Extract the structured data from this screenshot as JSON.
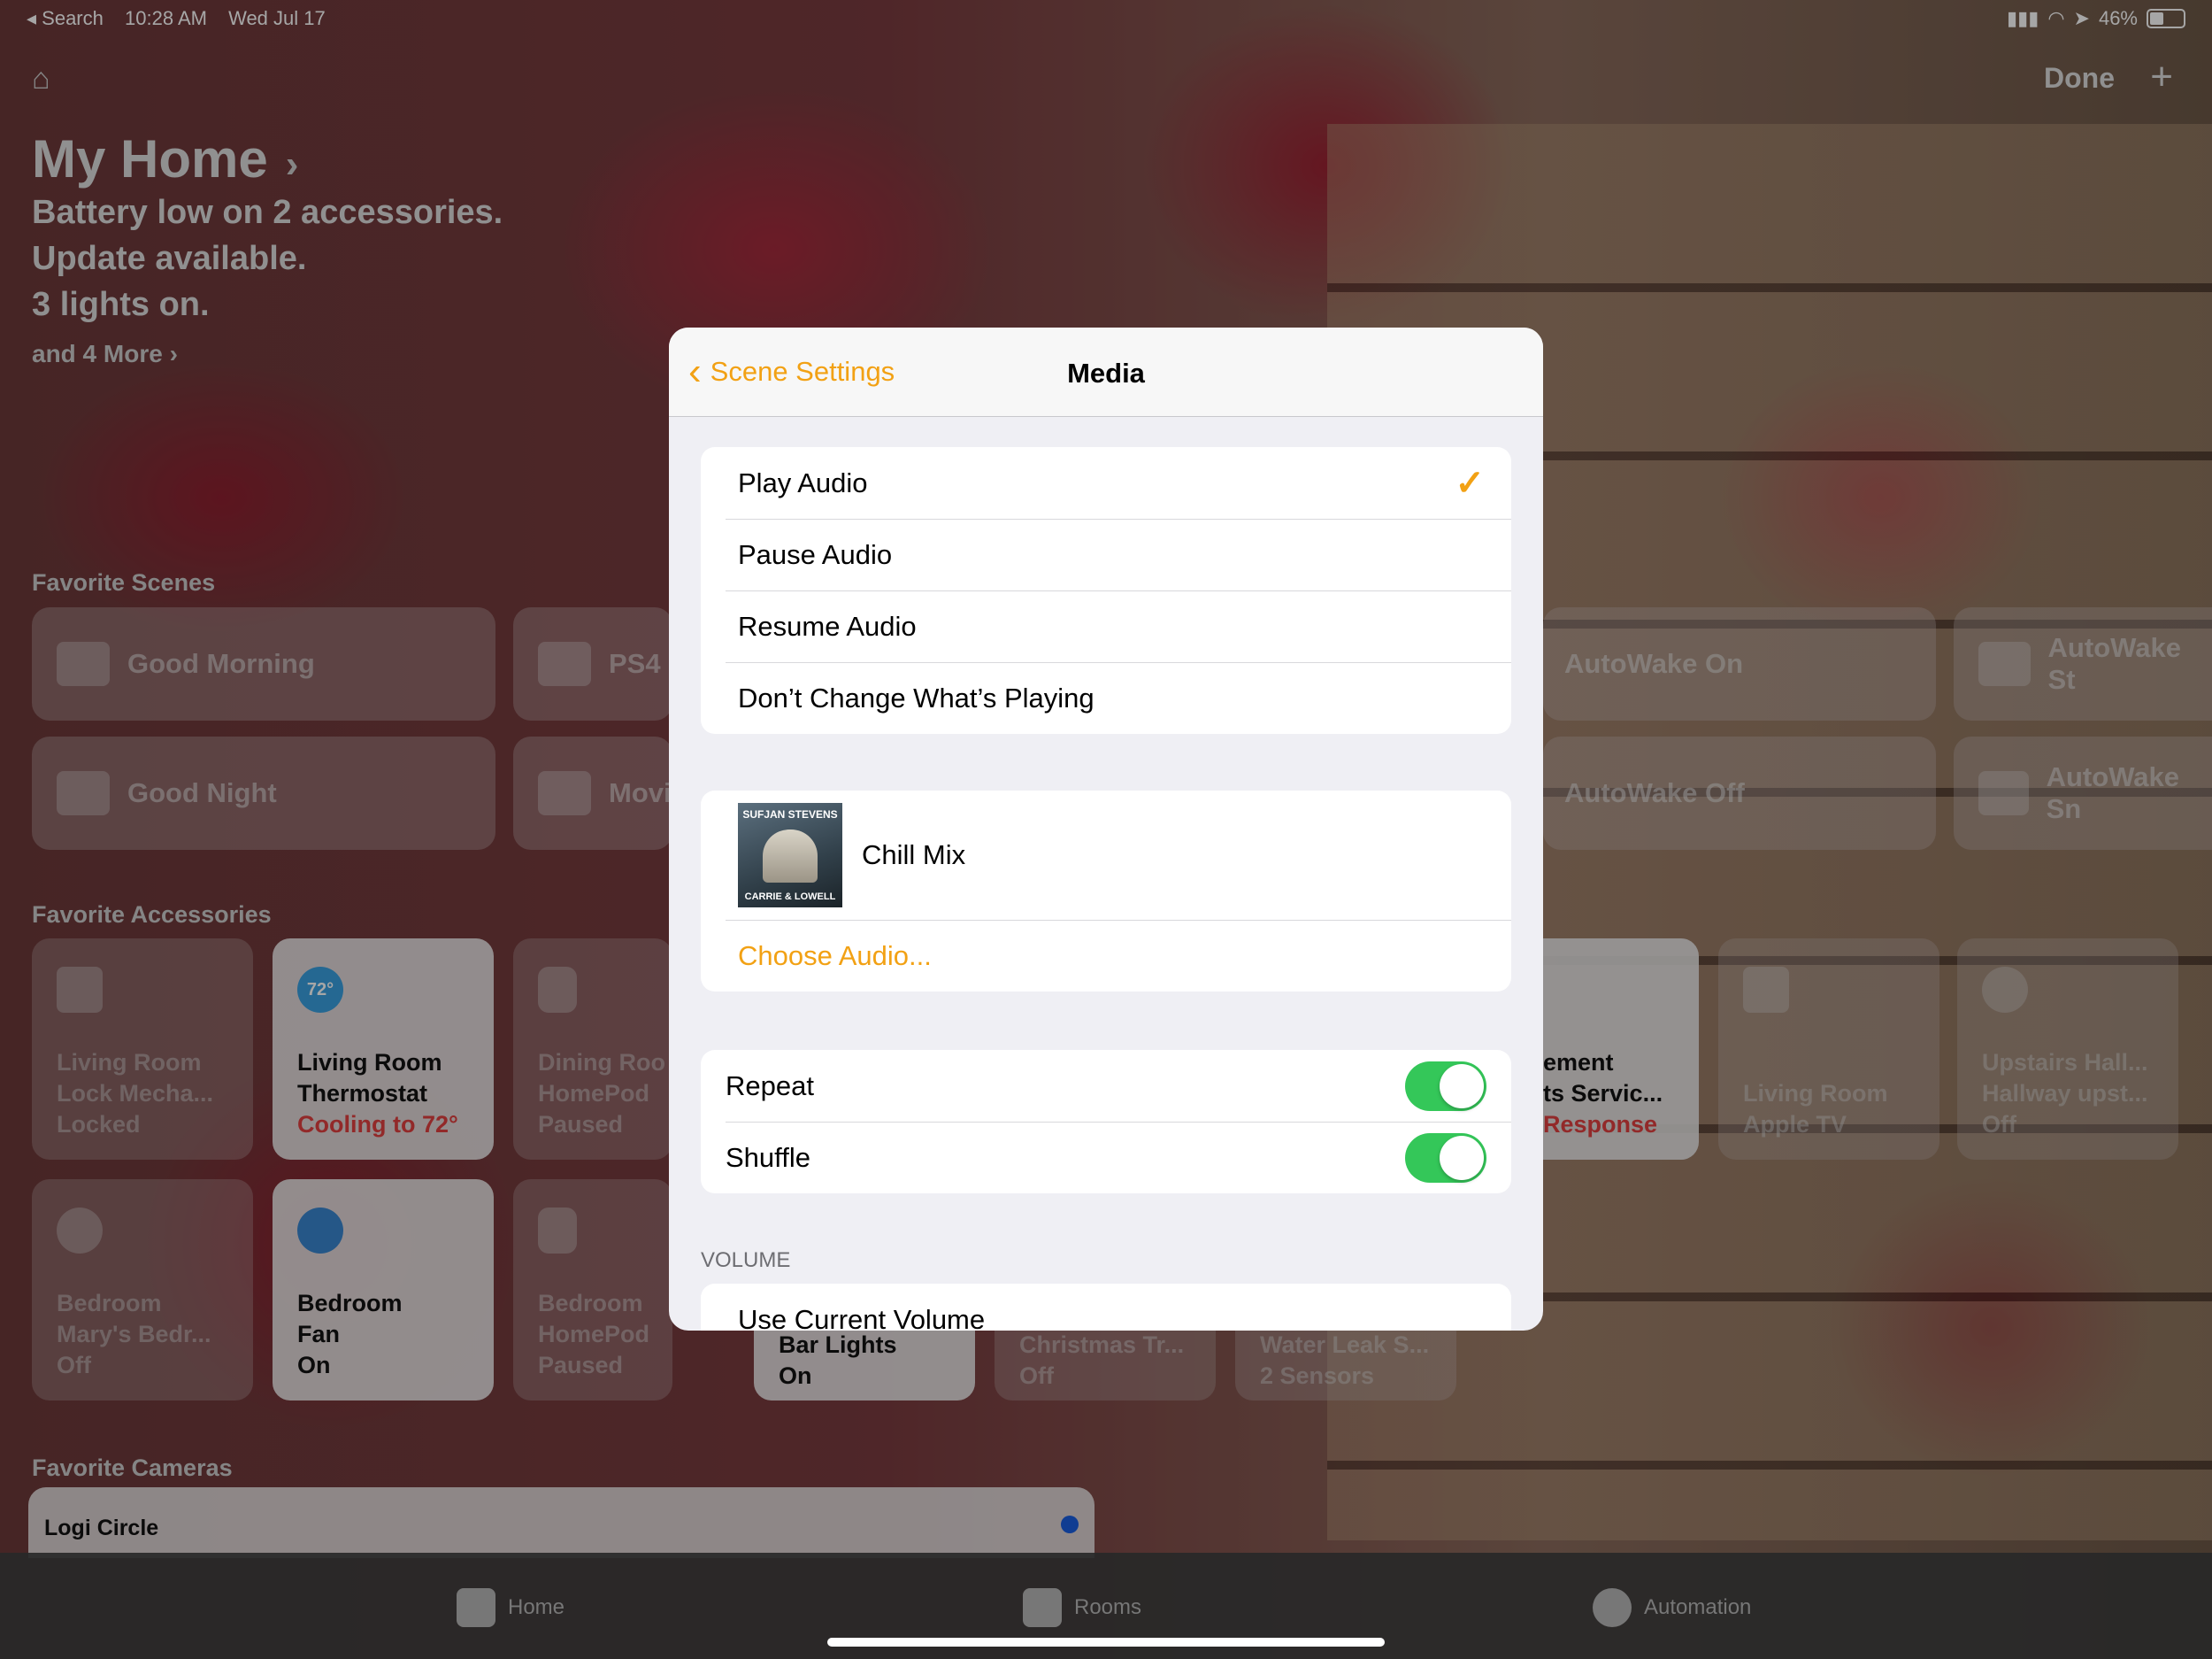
{
  "status_bar": {
    "back_app": "◂ Search",
    "time": "10:28 AM",
    "date": "Wed Jul 17",
    "battery": "46%",
    "battery_level": 0.46
  },
  "header": {
    "done_label": "Done",
    "add_label": "+"
  },
  "home": {
    "title": "My Home",
    "status_lines": [
      "Battery low on 2 accessories.",
      "Update available.",
      "3 lights on."
    ],
    "more_label": "and 4 More ›"
  },
  "favorite_scenes": {
    "title": "Favorite Scenes",
    "items": [
      "Good Morning",
      "PS4",
      "AutoWake On",
      "AutoWake St",
      "Good Night",
      "Movi",
      "AutoWake Off",
      "AutoWake Sn"
    ]
  },
  "favorite_accessories": {
    "title": "Favorite Accessories",
    "tiles": [
      {
        "name": "Living Room",
        "sub": "Lock Mecha...",
        "state": "Locked"
      },
      {
        "name": "Living Room",
        "sub": "Thermostat",
        "state": "Cooling to 72°",
        "badge": "72°"
      },
      {
        "name": "Dining Roo",
        "sub": "HomePod",
        "state": "Paused"
      },
      {
        "name": "ement",
        "sub": "ts Servic...",
        "state": "Response"
      },
      {
        "name": "Living Room",
        "sub": "Apple TV",
        "state": ""
      },
      {
        "name": "Upstairs Hall...",
        "sub": "Hallway upst...",
        "state": "Off"
      },
      {
        "name": "Bedroom",
        "sub": "Mary's Bedr...",
        "state": "Off"
      },
      {
        "name": "Bedroom",
        "sub": "Fan",
        "state": "On"
      },
      {
        "name": "Bedroom",
        "sub": "HomePod",
        "state": "Paused"
      },
      {
        "name": "Bar Lights",
        "sub": "",
        "state": "On"
      },
      {
        "name": "Christmas Tr...",
        "sub": "",
        "state": "Off"
      },
      {
        "name": "Water Leak S...",
        "sub": "",
        "state": "2 Sensors"
      }
    ]
  },
  "favorite_cameras": {
    "title": "Favorite Cameras",
    "camera_name": "Logi Circle"
  },
  "tab_bar": {
    "home": "Home",
    "rooms": "Rooms",
    "automation": "Automation"
  },
  "modal": {
    "back_label": "Scene Settings",
    "title": "Media",
    "options": [
      "Play Audio",
      "Pause Audio",
      "Resume Audio",
      "Don’t Change What’s Playing"
    ],
    "selected_option": "Play Audio",
    "album": {
      "artist": "SUFJAN STEVENS",
      "album": "CARRIE & LOWELL"
    },
    "playlist": "Chill Mix",
    "choose_audio": "Choose Audio...",
    "repeat_label": "Repeat",
    "repeat_on": true,
    "shuffle_label": "Shuffle",
    "shuffle_on": true,
    "volume_header": "VOLUME",
    "volume_option": "Use Current Volume"
  },
  "colors": {
    "accent": "#f2a114",
    "toggle_on": "#34c759",
    "alert_red": "#e04040"
  }
}
